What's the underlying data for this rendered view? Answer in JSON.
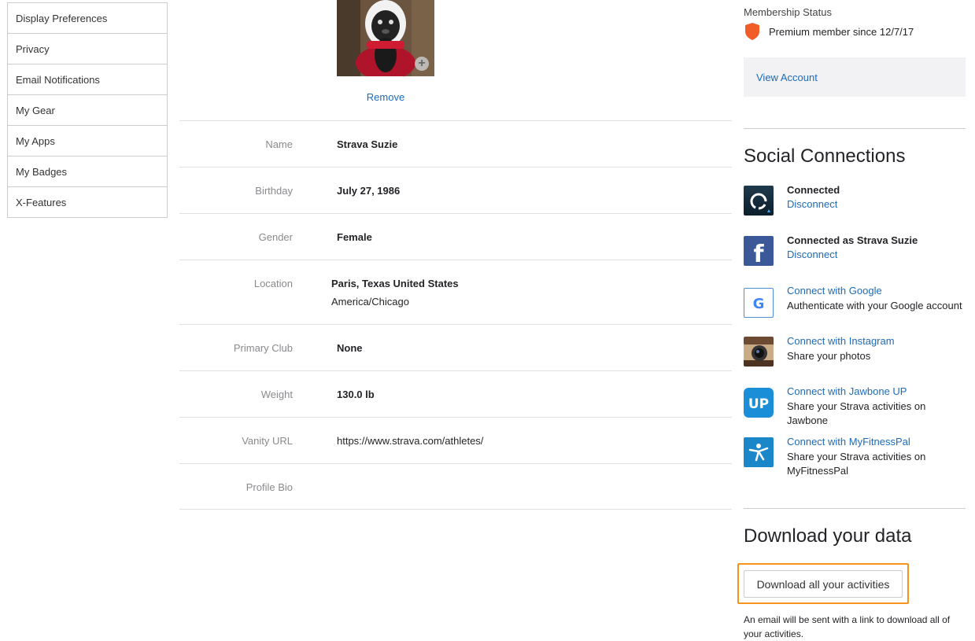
{
  "sidebar": {
    "items": [
      {
        "label": "Display Preferences"
      },
      {
        "label": "Privacy"
      },
      {
        "label": "Email Notifications"
      },
      {
        "label": "My Gear"
      },
      {
        "label": "My Apps"
      },
      {
        "label": "My Badges"
      },
      {
        "label": "X-Features"
      }
    ]
  },
  "profile": {
    "remove_label": "Remove",
    "rows": [
      {
        "label": "Name",
        "value": "Strava Suzie"
      },
      {
        "label": "Birthday",
        "value": "July 27, 1986"
      },
      {
        "label": "Gender",
        "value": "Female"
      },
      {
        "label": "Location",
        "value": "Paris, Texas United States",
        "sub": "America/Chicago"
      },
      {
        "label": "Primary Club",
        "value": "None"
      },
      {
        "label": "Weight",
        "value": "130.0 lb"
      },
      {
        "label": "Vanity URL",
        "value": "https://www.strava.com/athletes/"
      },
      {
        "label": "Profile Bio",
        "value": ""
      }
    ]
  },
  "membership": {
    "label": "Membership Status",
    "status": "Premium member since 12/7/17",
    "view_account": "View Account",
    "shield_color": "#f25c26"
  },
  "social": {
    "title": "Social Connections",
    "connections": [
      {
        "icon": "garmin-icon",
        "title": "Connected",
        "sub": "Disconnect"
      },
      {
        "icon": "facebook-icon",
        "title": "Connected as Strava Suzie",
        "sub": "Disconnect"
      },
      {
        "icon": "google-icon",
        "title": "Connect with Google",
        "sub": "Authenticate with your Google account"
      },
      {
        "icon": "instagram-icon",
        "title": "Connect with Instagram",
        "sub": "Share your photos"
      },
      {
        "icon": "jawbone-icon",
        "title": "Connect with Jawbone UP",
        "sub": "Share your Strava activities on Jawbone"
      },
      {
        "icon": "myfitnesspal-icon",
        "title": "Connect with MyFitnessPal",
        "sub": "Share your Strava activities on MyFitnessPal"
      }
    ]
  },
  "download": {
    "title": "Download your data",
    "button_label": "Download all your activities",
    "note": "An email will be sent with a link to download all of your activities.",
    "highlight_color": "#f7941e"
  }
}
